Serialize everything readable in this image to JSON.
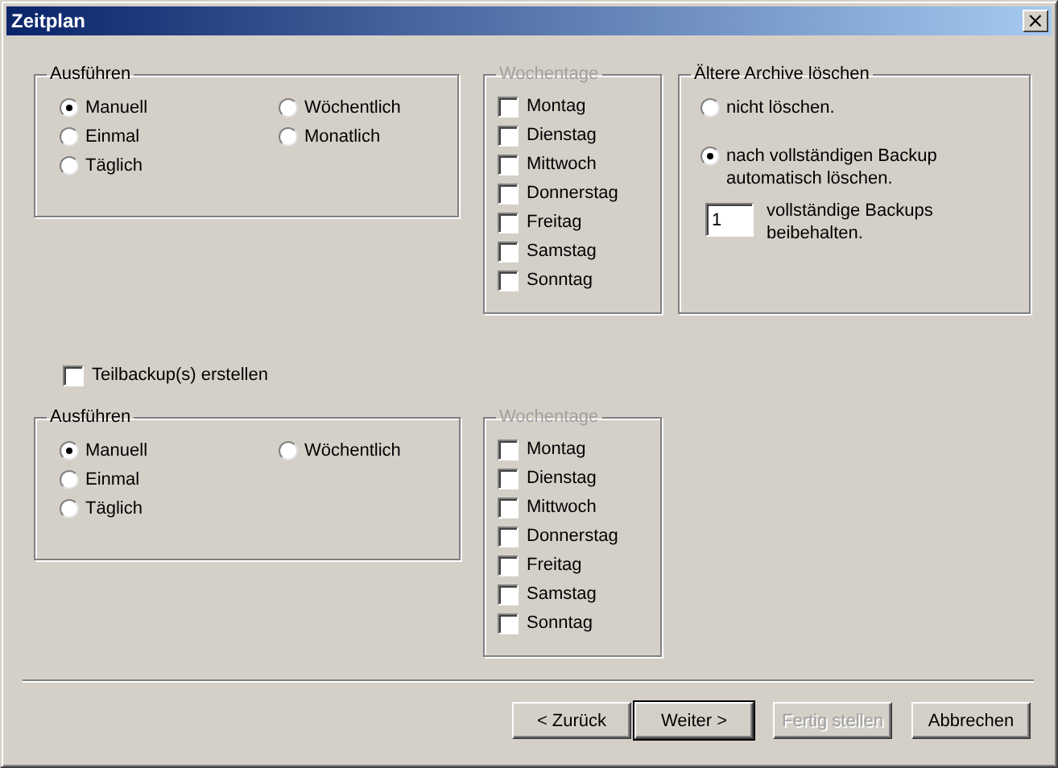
{
  "window": {
    "title": "Zeitplan",
    "close": "×"
  },
  "schedule": {
    "title": "Ausführen",
    "options": [
      {
        "label": "Manuell",
        "selected": true
      },
      {
        "label": "Einmal",
        "selected": false
      },
      {
        "label": "Täglich",
        "selected": false
      },
      {
        "label": "Wöchentlich",
        "selected": false
      },
      {
        "label": "Monatlich",
        "selected": false
      }
    ]
  },
  "weekdays": {
    "title": "Wochentage",
    "disabled": true,
    "days": [
      {
        "label": "Montag",
        "checked": false
      },
      {
        "label": "Dienstag",
        "checked": false
      },
      {
        "label": "Mittwoch",
        "checked": false
      },
      {
        "label": "Donnerstag",
        "checked": false
      },
      {
        "label": "Freitag",
        "checked": false
      },
      {
        "label": "Samstag",
        "checked": false
      },
      {
        "label": "Sonntag",
        "checked": false
      }
    ]
  },
  "archive": {
    "title": "Ältere Archive löschen",
    "options": [
      {
        "label": "nicht löschen.",
        "selected": false
      },
      {
        "label": "nach vollständigen Backup automatisch löschen.",
        "selected": true
      }
    ],
    "keep_count": {
      "value": "1",
      "label": "vollständige Backups beibehalten."
    }
  },
  "partial_backup": {
    "label": "Teilbackup(s) erstellen",
    "checked": false
  },
  "partial_schedule": {
    "title": "Ausführen",
    "options": [
      {
        "label": "Manuell",
        "selected": true
      },
      {
        "label": "Einmal",
        "selected": false
      },
      {
        "label": "Täglich",
        "selected": false
      },
      {
        "label": "Wöchentlich",
        "selected": false
      }
    ]
  },
  "partial_weekdays": {
    "title": "Wochentage",
    "disabled": true,
    "days": [
      {
        "label": "Montag",
        "checked": false
      },
      {
        "label": "Dienstag",
        "checked": false
      },
      {
        "label": "Mittwoch",
        "checked": false
      },
      {
        "label": "Donnerstag",
        "checked": false
      },
      {
        "label": "Freitag",
        "checked": false
      },
      {
        "label": "Samstag",
        "checked": false
      },
      {
        "label": "Sonntag",
        "checked": false
      }
    ]
  },
  "buttons": [
    {
      "label": "< Zurück",
      "default": false,
      "disabled": false
    },
    {
      "label": "Weiter >",
      "default": true,
      "disabled": false
    },
    {
      "label": "Fertig stellen",
      "default": false,
      "disabled": true
    },
    {
      "label": "Abbrechen",
      "default": false,
      "disabled": false
    }
  ]
}
